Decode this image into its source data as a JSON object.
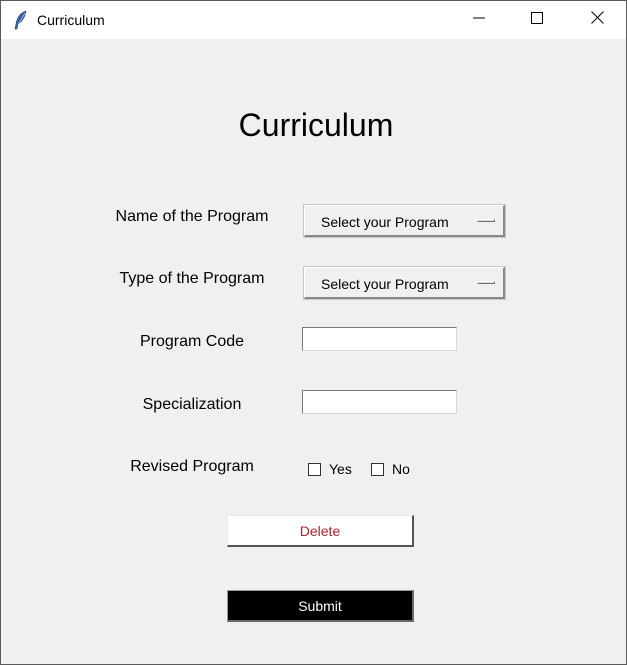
{
  "window": {
    "title": "Curriculum",
    "app_icon": "feather-icon",
    "controls": [
      "minimize-icon",
      "maximize-icon",
      "close-icon"
    ]
  },
  "form": {
    "heading": "Curriculum",
    "program_name": {
      "label": "Name of the Program",
      "selected": "Select your Program"
    },
    "program_type": {
      "label": "Type of the Program",
      "selected": "Select your Program"
    },
    "program_code": {
      "label": "Program Code",
      "value": ""
    },
    "specialization": {
      "label": "Specialization",
      "value": ""
    },
    "revised_program": {
      "label": "Revised Program",
      "options": [
        {
          "label": "Yes",
          "checked": false
        },
        {
          "label": "No",
          "checked": false
        }
      ]
    },
    "delete_label": "Delete",
    "submit_label": "Submit"
  },
  "colors": {
    "background": "#f0f0f0",
    "delete_text": "#a52a2a",
    "submit_bg": "#000000",
    "submit_text": "#ffffff"
  }
}
